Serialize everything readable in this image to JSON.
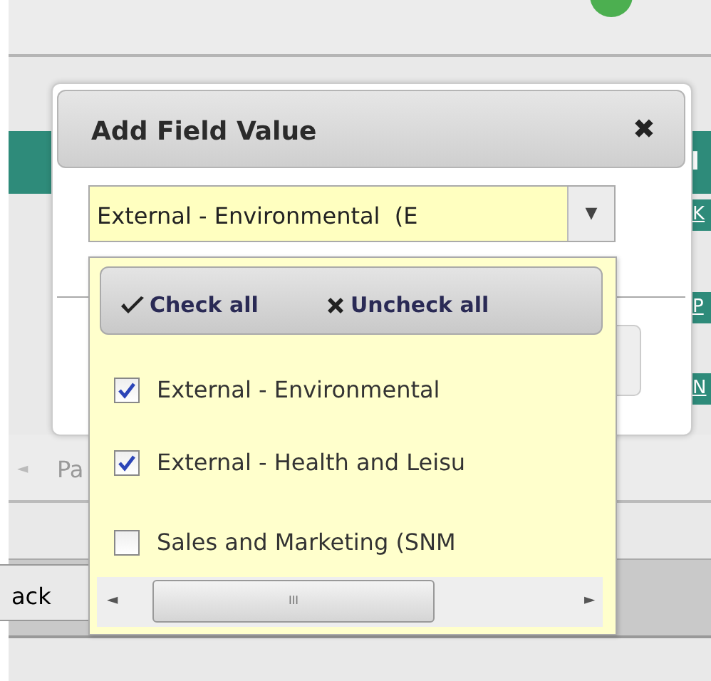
{
  "background": {
    "right_tab": "l",
    "right_links": [
      "K",
      "P",
      "N"
    ],
    "pager_arrow": "◄",
    "pager_text": "Pa",
    "back_button": "ack"
  },
  "dialog": {
    "title": "Add Field Value",
    "close": "✖",
    "select": {
      "value": "External - Environmental  (E",
      "arrow": "▼"
    },
    "dropdown": {
      "check_all": "Check all",
      "uncheck_all": "Uncheck all",
      "options": [
        {
          "label": "External - Environmental",
          "checked": true
        },
        {
          "label": "External - Health and Leisu",
          "checked": true
        },
        {
          "label": "Sales and Marketing (SNM",
          "checked": false
        }
      ],
      "scroll_left": "◄",
      "scroll_right": "►",
      "scroll_grip": "III"
    }
  }
}
